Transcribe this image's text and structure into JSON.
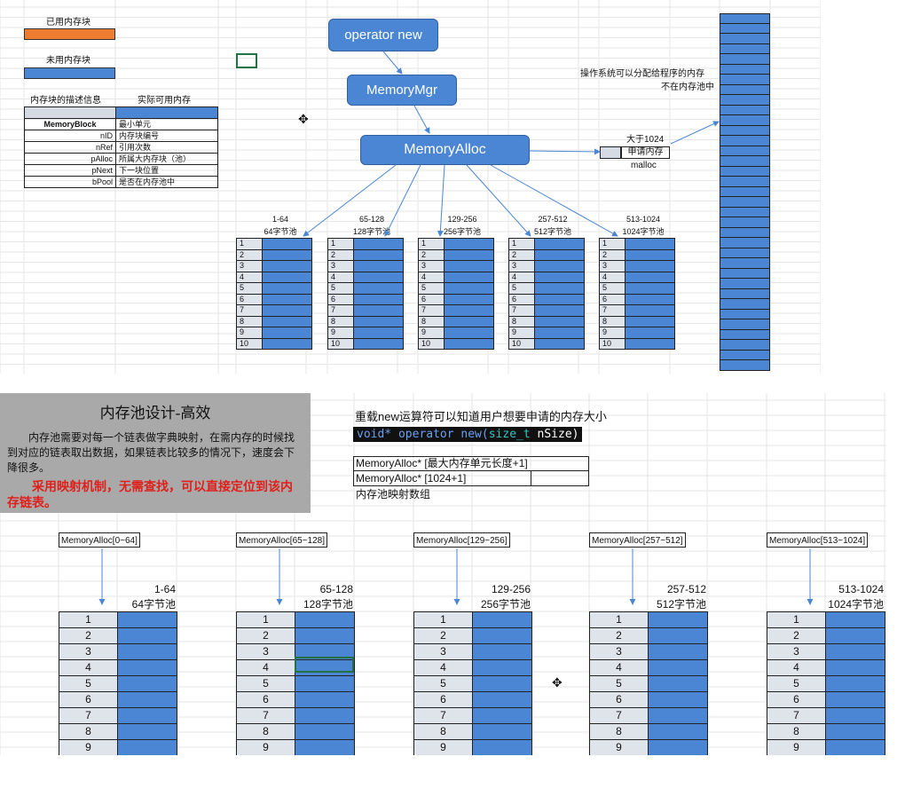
{
  "top": {
    "legend_used": "已用内存块",
    "legend_unused": "未用内存块",
    "desc_header_left": "内存块的描述信息",
    "desc_header_right": "实际可用内存",
    "desc_rows": [
      {
        "k": "MemoryBlock",
        "v": "最小单元"
      },
      {
        "k": "nID",
        "v": "内存块编号"
      },
      {
        "k": "nRef",
        "v": "引用次数"
      },
      {
        "k": "pAlloc",
        "v": "所属大内存块（池）"
      },
      {
        "k": "pNext",
        "v": "下一块位置"
      },
      {
        "k": "bPool",
        "v": "是否在内存池中"
      }
    ],
    "node_operator_new": "operator new",
    "node_memory_mgr": "MemoryMgr",
    "node_memory_alloc": "MemoryAlloc",
    "os_note_line1": "操作系统可以分配给程序的内存",
    "os_note_line2": "不在内存池中",
    "big_note_line1": "大于1024",
    "big_note_line2": "申请内存",
    "big_note_line3": "malloc",
    "pools": [
      {
        "range": "1-64",
        "label": "64字节池"
      },
      {
        "range": "65-128",
        "label": "128字节池"
      },
      {
        "range": "129-256",
        "label": "256字节池"
      },
      {
        "range": "257-512",
        "label": "512字节池"
      },
      {
        "range": "513-1024",
        "label": "1024字节池"
      }
    ],
    "rows": [
      "1",
      "2",
      "3",
      "4",
      "5",
      "6",
      "7",
      "8",
      "9",
      "10"
    ]
  },
  "bottom": {
    "title": "内存池设计-高效",
    "para": "内存池需要对每一个链表做字典映射，在需内存的时候找到对应的链表取出数据，如果链表比较多的情况下，速度会下降很多。",
    "red_text": "采用映射机制，无需查找，可以直接定位到该内存链表。",
    "overload_note": "重载new运算符可以知道用户想要申请的内存大小",
    "code_kw1": "void*",
    "code_fn": "operator new(",
    "code_kw2": "size_t",
    "code_arg": "nSize)",
    "array_line1": "MemoryAlloc* [最大内存单元长度+1]",
    "array_line2": "MemoryAlloc* [1024+1]",
    "array_label": "内存池映射数组",
    "tags": [
      "MemoryAlloc[0~64]",
      "MemoryAlloc[65~128]",
      "MemoryAlloc[129~256]",
      "MemoryAlloc[257~512]",
      "MemoryAlloc[513~1024]"
    ],
    "pools": [
      {
        "range": "1-64",
        "label": "64字节池"
      },
      {
        "range": "65-128",
        "label": "128字节池"
      },
      {
        "range": "129-256",
        "label": "256字节池"
      },
      {
        "range": "257-512",
        "label": "512字节池"
      },
      {
        "range": "513-1024",
        "label": "1024字节池"
      }
    ],
    "rows": [
      "1",
      "2",
      "3",
      "4",
      "5",
      "6",
      "7",
      "8",
      "9"
    ]
  },
  "colors": {
    "block_blue": "#4a86d4",
    "used_orange": "#ee7d31",
    "index_gray": "#dfe3ea",
    "note_gray": "#a9a9a9",
    "red_text": "#e0201b"
  }
}
